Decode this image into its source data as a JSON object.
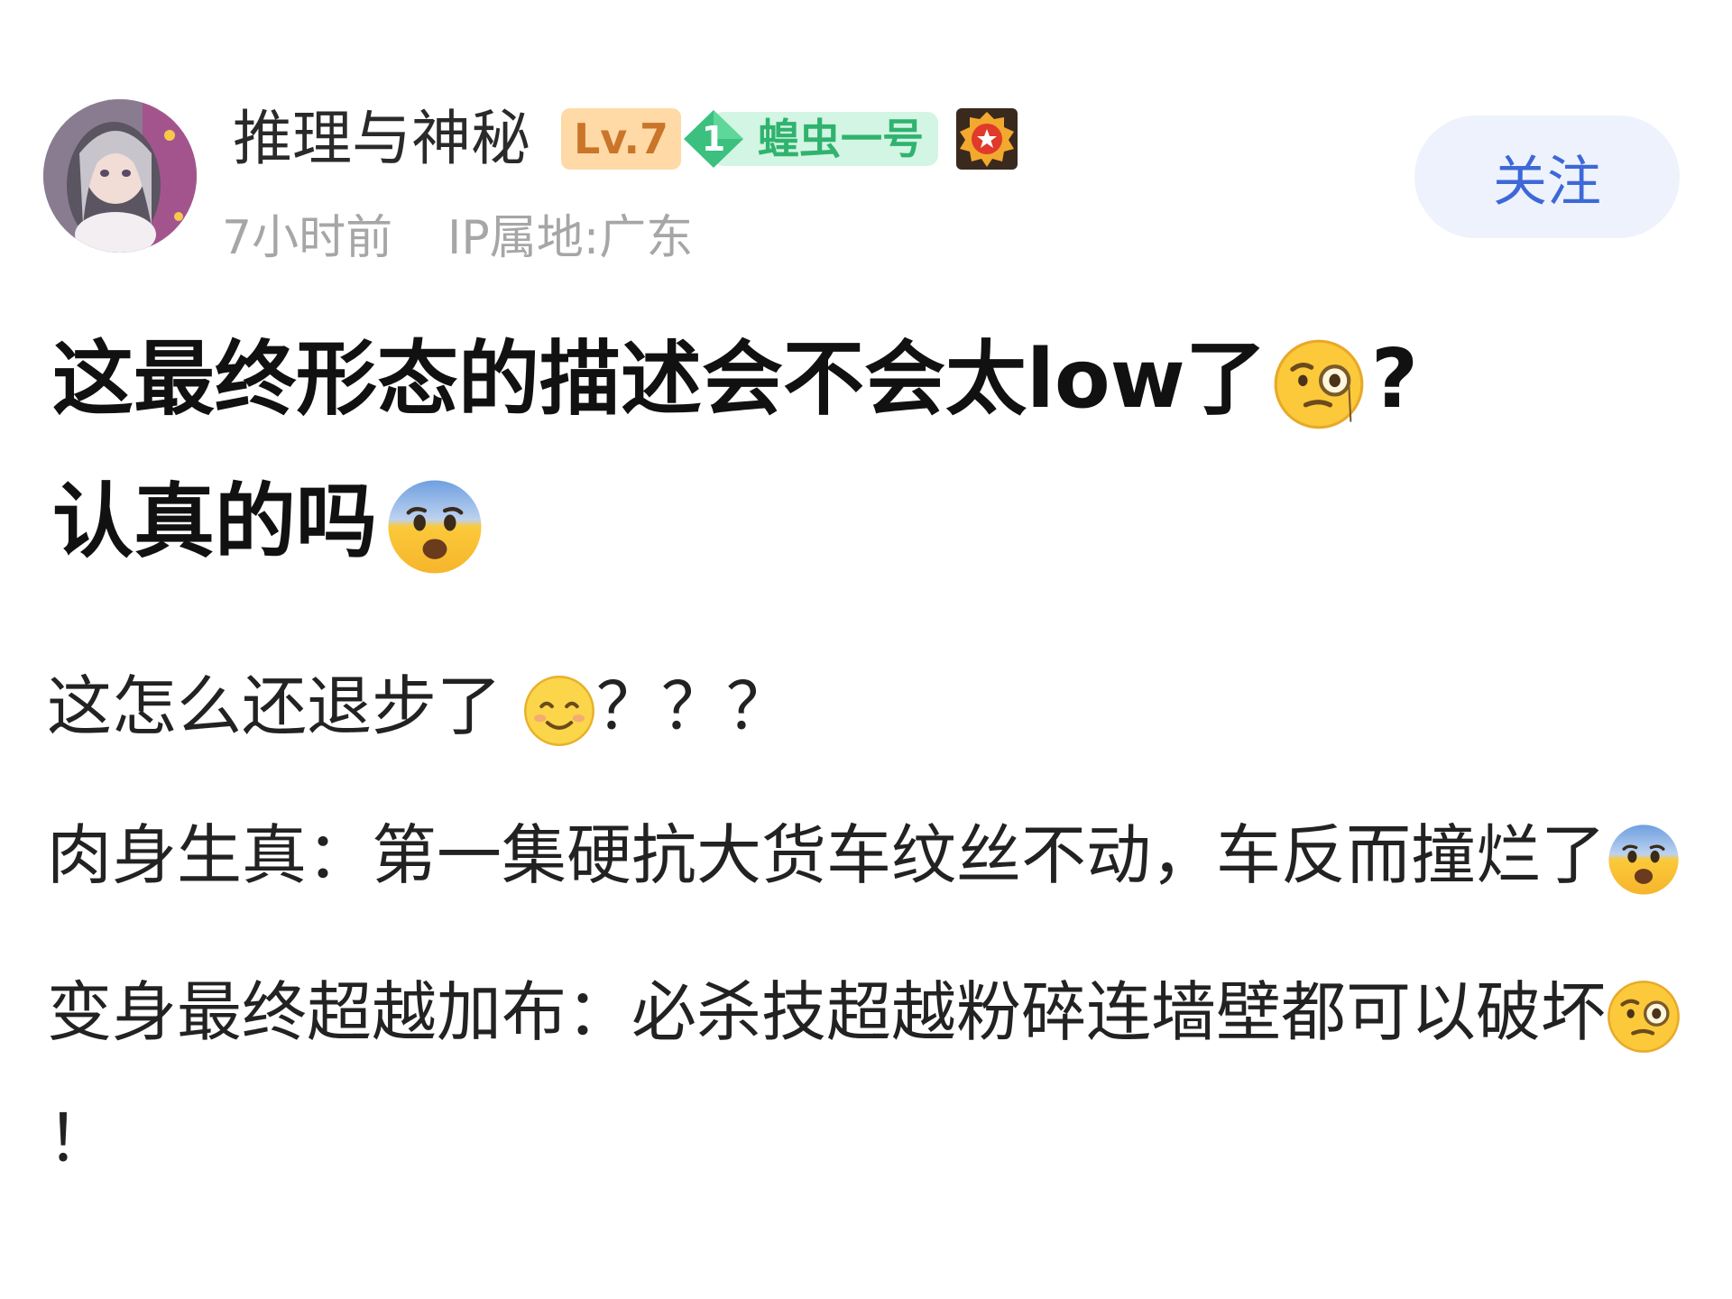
{
  "author": {
    "name": "推理与神秘",
    "level": "Lv.7",
    "title_badge_number": "1",
    "title_badge_text": "蝗虫一号",
    "time": "7小时前",
    "ip_location": "IP属地:广东"
  },
  "actions": {
    "follow_label": "关注"
  },
  "post": {
    "title_part1": "这最终形态的描述会不会太low了",
    "title_part2": "?",
    "title_part3": "认真的吗",
    "paragraphs": [
      {
        "text": "这怎么还退步了 ",
        "suffix": "？？？"
      },
      {
        "text": "肉身生真：第一集硬抗大货车纹丝不动，车反而撞烂了",
        "suffix": ""
      },
      {
        "text": "变身最终超越加布：必杀技超越粉碎连墙壁都可以破坏",
        "suffix": "！"
      }
    ]
  },
  "colors": {
    "follow_text": "#3d68d8",
    "follow_bg": "#eef2fc",
    "level_badge_bg": "#ffd9a6",
    "level_badge_text": "#c9752a",
    "title_badge_bg": "#d3f5e3",
    "title_badge_text": "#2fb36e",
    "meta_text": "#a6a6a6"
  },
  "icons": {
    "avatar": "user-avatar-anime",
    "title_badge_icon": "green-diamond-icon",
    "medal": "red-star-medal-icon",
    "emoji_monocle": "face-with-monocle-emoji",
    "emoji_fearful": "fearful-face-emoji",
    "emoji_smiling": "smiling-face-emoji"
  }
}
